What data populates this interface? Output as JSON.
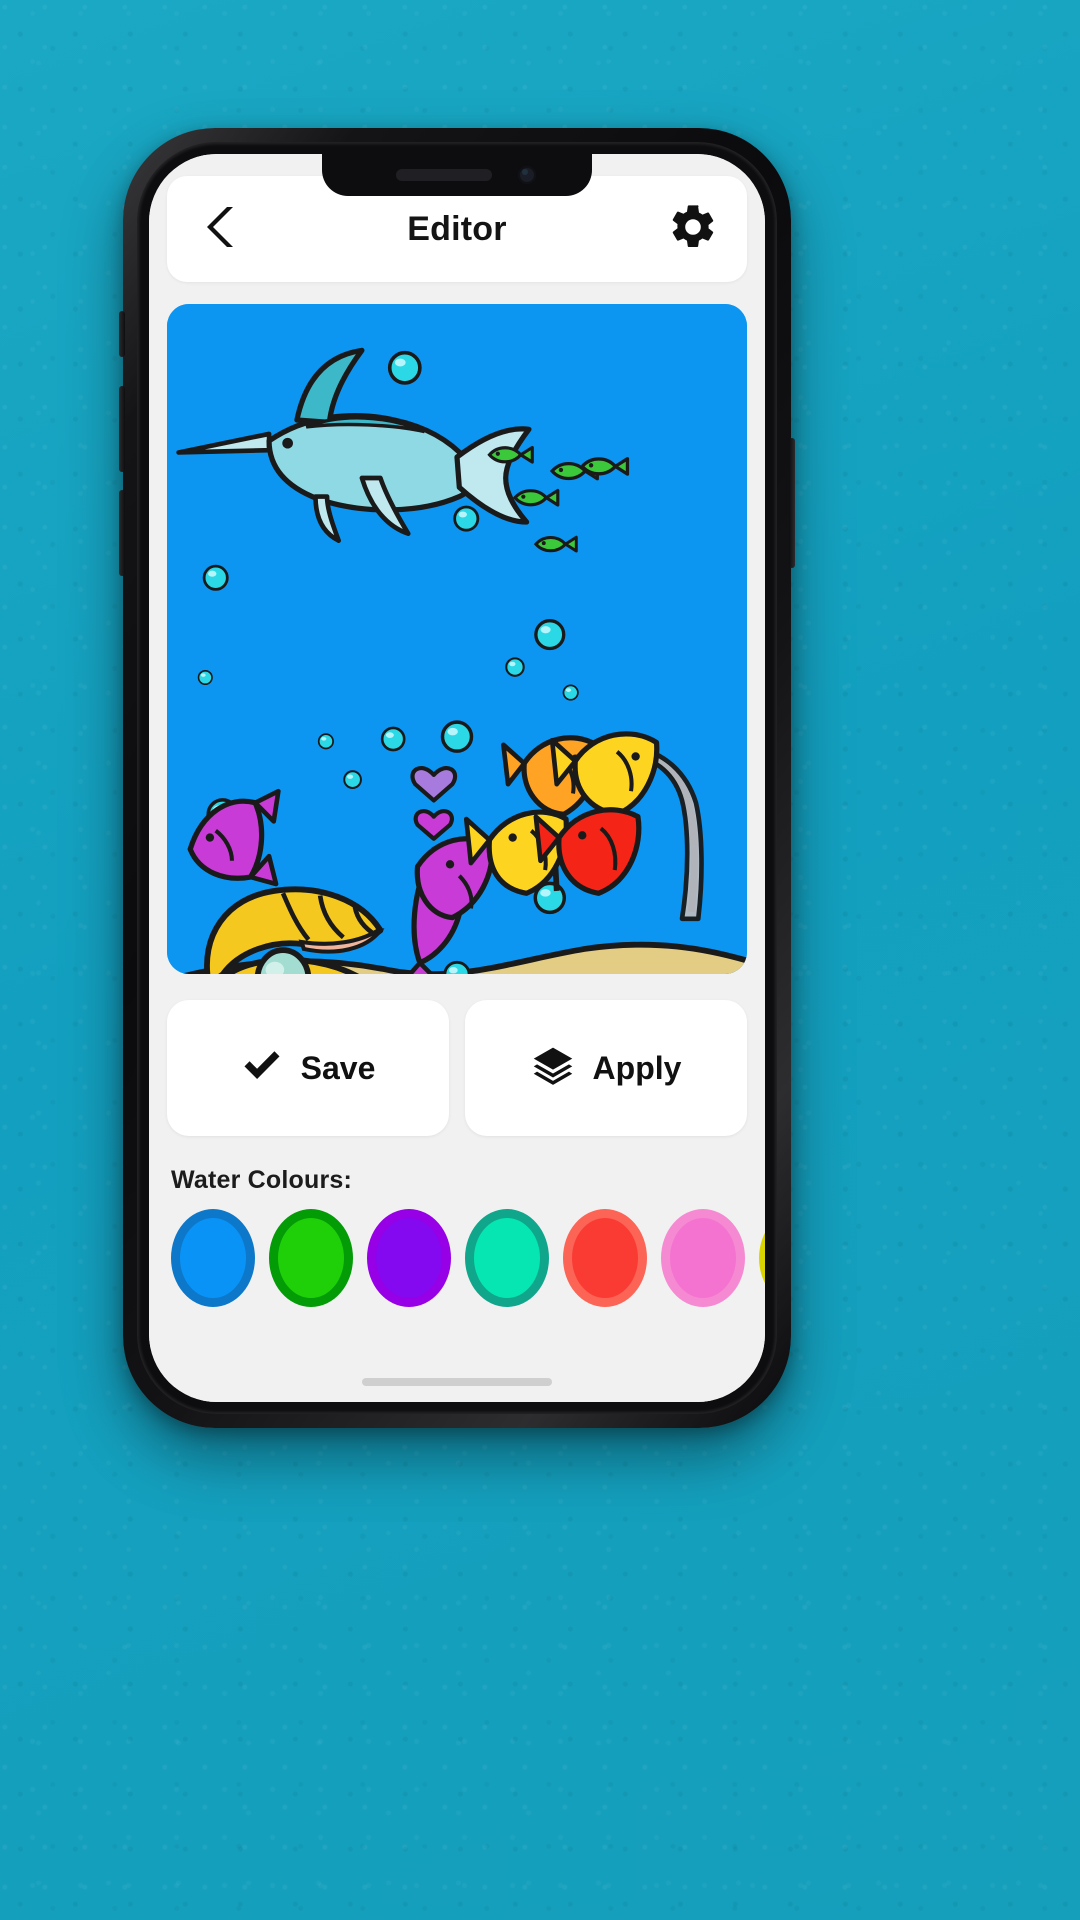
{
  "background": {
    "color": "#17a2bf"
  },
  "device": {
    "frame_color": "#0d0d0f",
    "screen_bg": "#f1f1f1"
  },
  "header": {
    "title": "Editor",
    "back_icon": "chevron-left-icon",
    "settings_icon": "gear-icon"
  },
  "canvas": {
    "scene_name": "underwater-coloring-scene",
    "water_color": "#0d95f2",
    "sand_color": "#e3cd84",
    "outline_color": "#1a1a1a",
    "elements": [
      "swordfish",
      "school-of-green-fish",
      "magenta-fish",
      "yellow-fish",
      "red-fish",
      "bubbles",
      "clam-with-pearl",
      "seashells",
      "seaweed"
    ]
  },
  "actions": {
    "save": {
      "label": "Save",
      "icon": "checkmark-icon"
    },
    "apply": {
      "label": "Apply",
      "icon": "layers-icon"
    }
  },
  "palette": {
    "title": "Water Colours:",
    "swatches": [
      {
        "name": "blue",
        "ring": "#0d78c9",
        "fill": "#0a93f7"
      },
      {
        "name": "green",
        "ring": "#039b06",
        "fill": "#1fd009"
      },
      {
        "name": "purple",
        "ring": "#9700e6",
        "fill": "#8408f0"
      },
      {
        "name": "teal",
        "ring": "#0fa68c",
        "fill": "#06e6b2"
      },
      {
        "name": "red",
        "ring": "#fc6456",
        "fill": "#fa3b34"
      },
      {
        "name": "pink",
        "ring": "#f58ad2",
        "fill": "#f473d0"
      },
      {
        "name": "yellow",
        "ring": "#d9d400",
        "fill": "#ebe406"
      }
    ]
  }
}
